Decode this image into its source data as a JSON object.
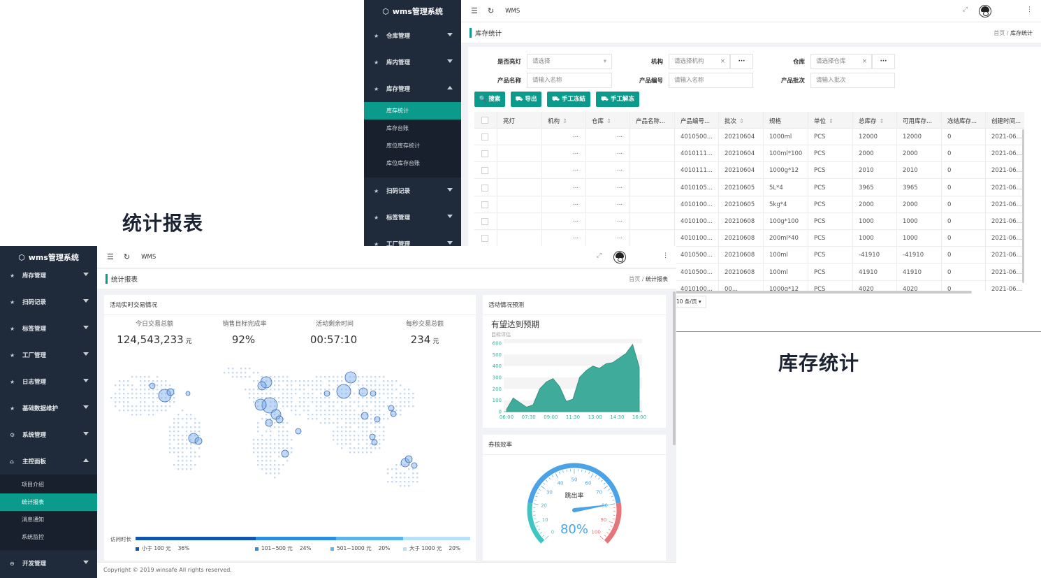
{
  "captions": {
    "report": "统计报表",
    "inventory": "库存统计"
  },
  "inv": {
    "logo": "wms管理系统",
    "nav": [
      {
        "label": "仓库管理",
        "open": false
      },
      {
        "label": "库内管理",
        "open": false
      },
      {
        "label": "库存管理",
        "open": true
      }
    ],
    "subs": [
      "库存统计",
      "库存台账",
      "库位库存统计",
      "库位库存台账"
    ],
    "nav2": [
      "扫码记录",
      "标签管理",
      "工厂管理"
    ],
    "top_title": "WMS",
    "page_title": "库存统计",
    "breadcrumb": {
      "home": "首页",
      "sep": "/",
      "current": "库存统计"
    },
    "filters": {
      "light_label": "是否亮灯",
      "light_ph": "请选择",
      "org_label": "机构",
      "org_ph": "请选择机构",
      "wh_label": "仓库",
      "wh_ph": "请选择仓库",
      "name_label": "产品名称",
      "name_ph": "请输入名称",
      "code_label": "产品编号",
      "code_ph": "请输入名称",
      "batch_label": "产品批次",
      "batch_ph": "请输入批次",
      "more": "···",
      "clear": "×"
    },
    "buttons": [
      "搜索",
      "导出",
      "手工冻結",
      "手工解冻"
    ],
    "columns": [
      "亮灯",
      "机构",
      "仓库",
      "产品名称...",
      "产品编号...",
      "批次",
      "规格",
      "单位",
      "总库存",
      "可用库存...",
      "冻结库存...",
      "创建时间..."
    ],
    "ellipsis": "...",
    "rows": [
      [
        "4010500...",
        "20210604",
        "1000ml",
        "PCS",
        "12000",
        "12000",
        "0",
        "2021-06..."
      ],
      [
        "4010111...",
        "20210604",
        "100ml*100",
        "PCS",
        "2000",
        "2000",
        "0",
        "2021-06..."
      ],
      [
        "4010111...",
        "20210604",
        "1000g*12",
        "PCS",
        "2010",
        "2010",
        "0",
        "2021-06..."
      ],
      [
        "4010105...",
        "20210605",
        "5L*4",
        "PCS",
        "3965",
        "3965",
        "0",
        "2021-06..."
      ],
      [
        "4010100...",
        "20210605",
        "5kg*4",
        "PCS",
        "2000",
        "2000",
        "0",
        "2021-06..."
      ],
      [
        "4010100...",
        "20210608",
        "100g*100",
        "PCS",
        "1000",
        "1000",
        "0",
        "2021-06..."
      ],
      [
        "4010100...",
        "20210608",
        "200ml*40",
        "PCS",
        "1000",
        "1000",
        "0",
        "2021-06..."
      ],
      [
        "4010500...",
        "20210608",
        "100ml",
        "PCS",
        "-41910",
        "-41910",
        "0",
        "2021-06..."
      ],
      [
        "4010500...",
        "20210608",
        "100ml",
        "PCS",
        "41910",
        "41910",
        "0",
        "2021-06..."
      ],
      [
        "4010100...",
        "00...",
        "1000g*12",
        "PCS",
        "4020",
        "4020",
        "0",
        "2021-06..."
      ]
    ],
    "pagesize": "10 条/页"
  },
  "rep": {
    "logo": "wms管理系统",
    "nav": [
      "库存管理",
      "扫码记录",
      "标签管理",
      "工厂管理",
      "日志管理",
      "基础数据维护",
      "系统管理",
      "主控面板"
    ],
    "subs": [
      "项目介绍",
      "统计报表",
      "消息通知",
      "系统监控"
    ],
    "nav_last": "开发管理",
    "top_title": "WMS",
    "page_title": "统计报表",
    "breadcrumb": {
      "home": "首页",
      "sep": "/",
      "current": "统计报表"
    },
    "map_card": {
      "title": "活动实时交易情况",
      "kpis": [
        {
          "label": "今日交易总额",
          "value": "124,543,233",
          "unit": "元"
        },
        {
          "label": "销售目标完成率",
          "value": "92%",
          "unit": ""
        },
        {
          "label": "活动剩余时间",
          "value": "00:57:10",
          "unit": ""
        },
        {
          "label": "每秒交易总额",
          "value": "234",
          "unit": "元"
        }
      ],
      "bar_label": "访问时长",
      "legend": [
        {
          "label": "小于 100 元",
          "pct": "36%",
          "value": 36,
          "color": "#1155b0"
        },
        {
          "label": "101~500 元",
          "pct": "24%",
          "value": 24,
          "color": "#2a8fe3"
        },
        {
          "label": "501~1000 元",
          "pct": "20%",
          "value": 20,
          "color": "#5bb4ee"
        },
        {
          "label": "大于 1000 元",
          "pct": "20%",
          "value": 20,
          "color": "#b8e0f6"
        }
      ]
    },
    "forecast": {
      "title": "活动情况预测",
      "headline": "有望达到预期",
      "sub": "目标评估",
      "chart_data": {
        "type": "area",
        "x": [
          "06:00",
          "07:30",
          "09:00",
          "11:30",
          "13:00",
          "14:30",
          "16:00"
        ],
        "ylim": [
          0,
          600
        ],
        "yticks": [
          0,
          100,
          200,
          300,
          400,
          500,
          600
        ],
        "values": [
          20,
          120,
          80,
          40,
          60,
          200,
          260,
          290,
          220,
          90,
          110,
          300,
          360,
          400,
          380,
          420,
          430,
          470,
          510,
          590,
          390
        ],
        "color": "#3fac9b"
      }
    },
    "gauge": {
      "title": "券核效率",
      "label": "跳出率",
      "value": "80%",
      "pct": 80,
      "ticks": [
        "0",
        "10",
        "20",
        "30",
        "40",
        "50",
        "60",
        "70",
        "80",
        "90",
        "100"
      ]
    },
    "footer": "Copyright © 2019 winsafe All rights reserved."
  }
}
